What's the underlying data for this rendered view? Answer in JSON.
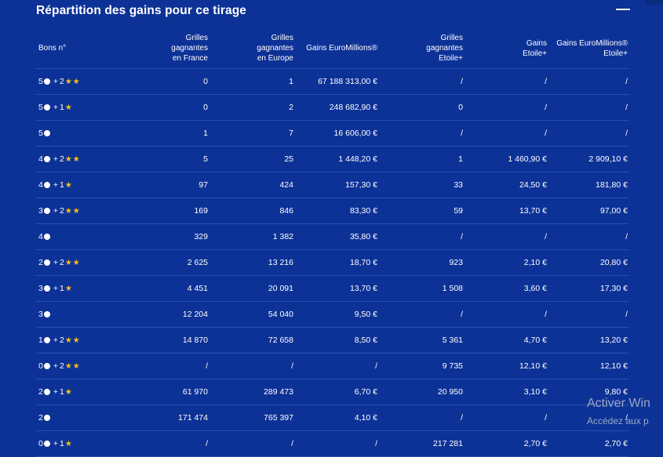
{
  "title": "Répartition des gains pour ce tirage",
  "headers": [
    "Bons n°",
    "Grilles\ngagnantes\nen France",
    "Grilles\ngagnantes\nen Europe",
    "Gains EuroMillions®",
    "Grilles\ngagnantes\nEtoile+",
    "Gains\nEtoile+",
    "Gains EuroMillions®\nEtoile+"
  ],
  "colors": {
    "background": "#0d3297",
    "star": "#f5c21b",
    "text": "#ffffff"
  },
  "icons": {
    "ball": "white-dot-icon",
    "star": "gold-star-icon"
  },
  "rows": [
    {
      "balls": "5",
      "stars": 2,
      "cells": [
        "0",
        "1",
        "67 188 313,00 €",
        "/",
        "/",
        "/"
      ]
    },
    {
      "balls": "5",
      "stars": 1,
      "cells": [
        "0",
        "2",
        "248 682,90 €",
        "0",
        "/",
        "/"
      ]
    },
    {
      "balls": "5",
      "stars": 0,
      "cells": [
        "1",
        "7",
        "16 606,00 €",
        "/",
        "/",
        "/"
      ]
    },
    {
      "balls": "4",
      "stars": 2,
      "cells": [
        "5",
        "25",
        "1 448,20 €",
        "1",
        "1 460,90 €",
        "2 909,10 €"
      ]
    },
    {
      "balls": "4",
      "stars": 1,
      "cells": [
        "97",
        "424",
        "157,30 €",
        "33",
        "24,50 €",
        "181,80 €"
      ]
    },
    {
      "balls": "3",
      "stars": 2,
      "cells": [
        "169",
        "846",
        "83,30 €",
        "59",
        "13,70 €",
        "97,00 €"
      ]
    },
    {
      "balls": "4",
      "stars": 0,
      "cells": [
        "329",
        "1 382",
        "35,80 €",
        "/",
        "/",
        "/"
      ]
    },
    {
      "balls": "2",
      "stars": 2,
      "cells": [
        "2 625",
        "13 216",
        "18,70 €",
        "923",
        "2,10 €",
        "20,80 €"
      ]
    },
    {
      "balls": "3",
      "stars": 1,
      "cells": [
        "4 451",
        "20 091",
        "13,70 €",
        "1 508",
        "3,60 €",
        "17,30 €"
      ]
    },
    {
      "balls": "3",
      "stars": 0,
      "cells": [
        "12 204",
        "54 040",
        "9,50 €",
        "/",
        "/",
        "/"
      ]
    },
    {
      "balls": "1",
      "stars": 2,
      "cells": [
        "14 870",
        "72 658",
        "8,50 €",
        "5 361",
        "4,70 €",
        "13,20 €"
      ]
    },
    {
      "balls": "0",
      "stars": 2,
      "cells": [
        "/",
        "/",
        "/",
        "9 735",
        "12,10 €",
        "12,10 €"
      ]
    },
    {
      "balls": "2",
      "stars": 1,
      "cells": [
        "61 970",
        "289 473",
        "6,70 €",
        "20 950",
        "3,10 €",
        "9,80 €"
      ]
    },
    {
      "balls": "2",
      "stars": 0,
      "cells": [
        "171 474",
        "765 397",
        "4,10 €",
        "/",
        "/",
        "/"
      ]
    },
    {
      "balls": "0",
      "stars": 1,
      "cells": [
        "/",
        "/",
        "/",
        "217 281",
        "2,70 €",
        "2,70 €"
      ]
    }
  ],
  "plus_sign": "+",
  "watermark": {
    "line1": "Activer Win",
    "line2": "Accédez aux p"
  }
}
